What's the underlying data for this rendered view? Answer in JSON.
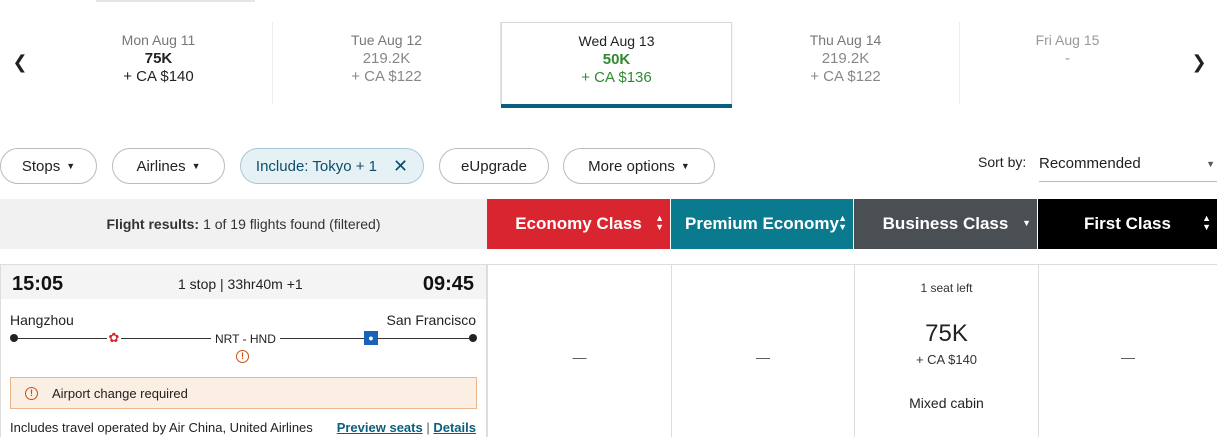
{
  "date_strip": {
    "prev_icon": "chevron-left-icon",
    "next_icon": "chevron-right-icon",
    "dates": [
      {
        "day": "Mon Aug 11",
        "miles": "75K",
        "tax": "+ CA $140"
      },
      {
        "day": "Tue Aug 12",
        "miles": "219.2K",
        "tax": "+ CA $122"
      },
      {
        "day": "Wed Aug 13",
        "miles": "50K",
        "tax": "+ CA $136"
      },
      {
        "day": "Thu Aug 14",
        "miles": "219.2K",
        "tax": "+ CA $122"
      },
      {
        "day": "Fri Aug 15",
        "miles": "-",
        "tax": ""
      }
    ],
    "selected_index": 2
  },
  "filters": {
    "stops": "Stops",
    "airlines": "Airlines",
    "include": "Include: Tokyo + 1",
    "eupgrade": "eUpgrade",
    "more": "More options"
  },
  "sort": {
    "label": "Sort by:",
    "value": "Recommended"
  },
  "results": {
    "label": "Flight results:",
    "count": "1 of 19 flights found (filtered)"
  },
  "cabins": {
    "economy": "Economy Class",
    "premium": "Premium Economy",
    "business": "Business Class",
    "first": "First Class"
  },
  "colors": {
    "economy": "#d9252f",
    "premium": "#0a7a8f",
    "business": "#4a4f54",
    "first": "#000000",
    "accent": "#0b5f7e",
    "price_green": "#2f8a2f"
  },
  "flight": {
    "depart_time": "15:05",
    "arrive_time": "09:45",
    "stops_duration": "1 stop | 33hr40m +1",
    "origin": "Hangzhou",
    "destination": "San Francisco",
    "connection": "NRT - HND",
    "alert": "Airport change required",
    "operated_by": "Includes travel operated by Air China, United Airlines",
    "preview_seats": "Preview seats",
    "separator": "|",
    "details": "Details"
  },
  "fares": {
    "economy": "—",
    "premium": "—",
    "business": {
      "seats": "1 seat left",
      "miles": "75K",
      "tax": "+ CA $140",
      "note": "Mixed cabin"
    },
    "first": "—"
  }
}
